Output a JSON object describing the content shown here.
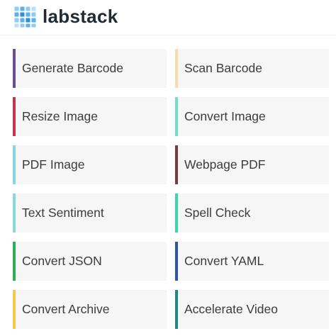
{
  "header": {
    "brand": "labstack",
    "logo_icon": "cube-grid-icon"
  },
  "tools": [
    {
      "label": "Generate Barcode",
      "color": "#6a4c93",
      "id": "generate-barcode"
    },
    {
      "label": "Scan Barcode",
      "color": "#f9dca8",
      "id": "scan-barcode"
    },
    {
      "label": "Resize Image",
      "color": "#c0364f",
      "id": "resize-image"
    },
    {
      "label": "Convert Image",
      "color": "#6fe0c4",
      "id": "convert-image"
    },
    {
      "label": "PDF Image",
      "color": "#86d5e0",
      "id": "pdf-image"
    },
    {
      "label": "Webpage PDF",
      "color": "#7a3d3d",
      "id": "webpage-pdf"
    },
    {
      "label": "Text Sentiment",
      "color": "#8ad8dc",
      "id": "text-sentiment"
    },
    {
      "label": "Spell Check",
      "color": "#37d9a4",
      "id": "spell-check"
    },
    {
      "label": "Convert JSON",
      "color": "#2fae55",
      "id": "convert-json"
    },
    {
      "label": "Convert YAML",
      "color": "#2a56a6",
      "id": "convert-yaml"
    },
    {
      "label": "Convert Archive",
      "color": "#f3c84f",
      "id": "convert-archive"
    },
    {
      "label": "Accelerate Video",
      "color": "#1f8a84",
      "id": "accelerate-video"
    }
  ]
}
